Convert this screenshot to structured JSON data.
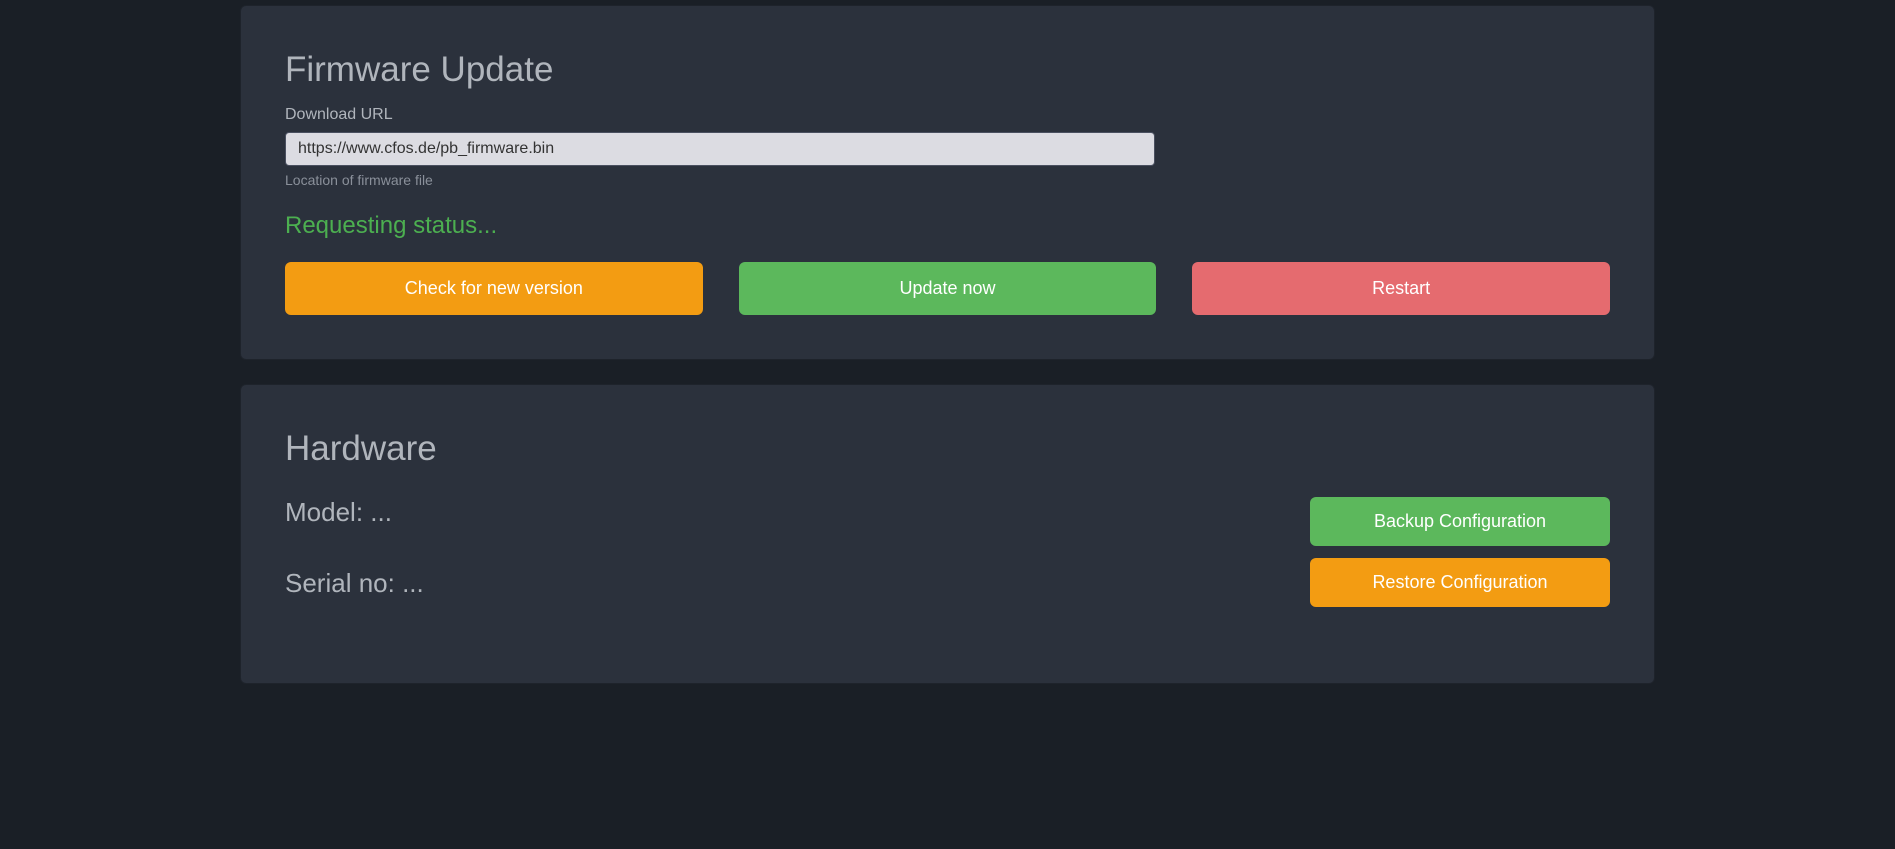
{
  "firmware": {
    "title": "Firmware Update",
    "download_url_label": "Download URL",
    "download_url_value": "https://www.cfos.de/pb_firmware.bin",
    "download_url_hint": "Location of firmware file",
    "status": "Requesting status...",
    "buttons": {
      "check": "Check for new version",
      "update": "Update now",
      "restart": "Restart"
    }
  },
  "hardware": {
    "title": "Hardware",
    "model_label": "Model: ",
    "model_value": "...",
    "serial_label": "Serial no: ",
    "serial_value": "...",
    "buttons": {
      "backup": "Backup Configuration",
      "restore": "Restore Configuration"
    }
  }
}
